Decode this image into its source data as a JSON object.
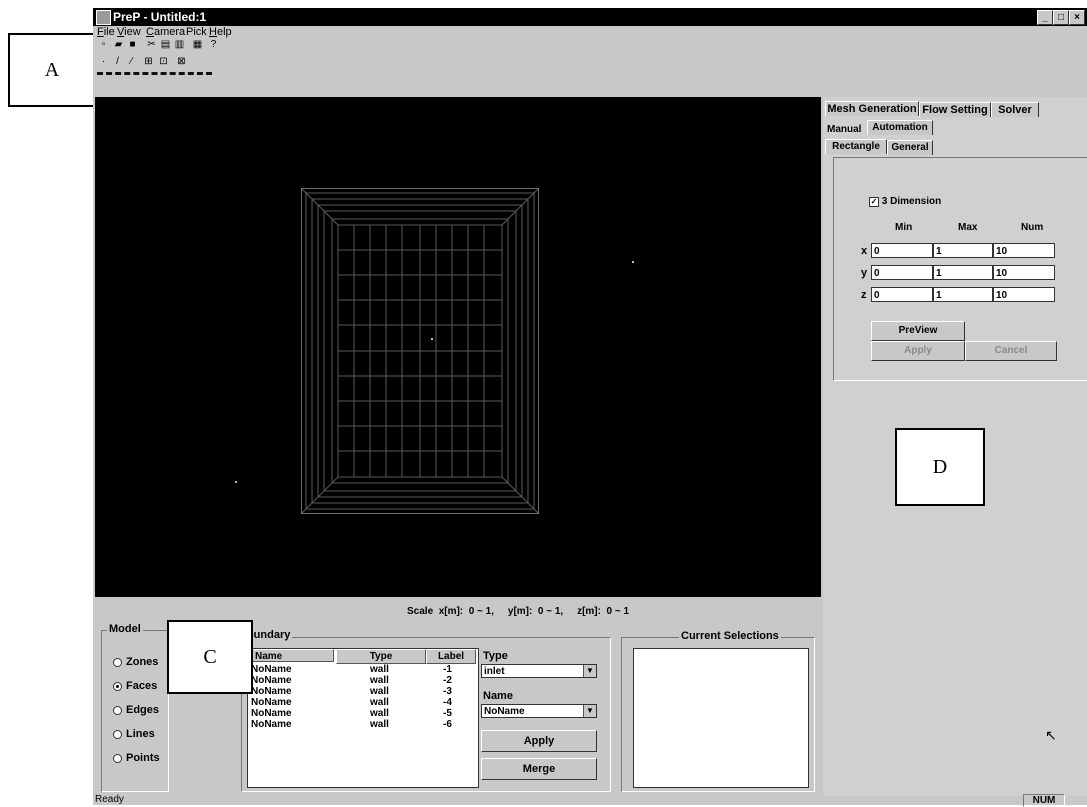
{
  "window": {
    "title": "PreP - Untitled:1",
    "status": "Ready",
    "num_indicator": "NUM"
  },
  "menu": [
    {
      "label": "File",
      "underline": "F",
      "rest": "ile"
    },
    {
      "label": "View",
      "underline": "V",
      "rest": "iew"
    },
    {
      "label": "Camera",
      "underline": "C",
      "rest": "amera"
    },
    {
      "label": "Pick",
      "underline": "",
      "rest": "Pick"
    },
    {
      "label": "Help",
      "underline": "H",
      "rest": "elp"
    }
  ],
  "callouts": {
    "a": "A",
    "c": "C",
    "d": "D"
  },
  "scale": {
    "text": "Scale  x[m]:  0 ~ 1,     y[m]:  0 ~ 1,     z[m]:  0 ~ 1"
  },
  "model": {
    "title": "Model",
    "options": [
      "Zones",
      "Faces",
      "Edges",
      "Lines",
      "Points"
    ],
    "selected": "Faces"
  },
  "boundary": {
    "title": "Boundary",
    "columns": [
      "Name",
      "Type",
      "Label"
    ],
    "rows": [
      {
        "name": "NoName",
        "type": "wall",
        "label": "-1"
      },
      {
        "name": "NoName",
        "type": "wall",
        "label": "-2"
      },
      {
        "name": "NoName",
        "type": "wall",
        "label": "-3"
      },
      {
        "name": "NoName",
        "type": "wall",
        "label": "-4"
      },
      {
        "name": "NoName",
        "type": "wall",
        "label": "-5"
      },
      {
        "name": "NoName",
        "type": "wall",
        "label": "-6"
      }
    ],
    "type_label": "Type",
    "type_value": "inlet",
    "name_label": "Name",
    "name_value": "NoName",
    "apply": "Apply",
    "merge": "Merge"
  },
  "current_selections": {
    "title": "Current Selections"
  },
  "tabs": {
    "main": [
      "Mesh Generation",
      "Flow Setting",
      "Solver"
    ],
    "sub": [
      "Manual",
      "Automation"
    ],
    "shape": [
      "Rectangle",
      "General"
    ]
  },
  "mesh": {
    "three_d_label": "3 Dimension",
    "three_d_checked": true,
    "headers": [
      "Min",
      "Max",
      "Num"
    ],
    "axes": [
      {
        "axis": "x",
        "min": "0",
        "max": "1",
        "num": "10"
      },
      {
        "axis": "y",
        "min": "0",
        "max": "1",
        "num": "10"
      },
      {
        "axis": "z",
        "min": "0",
        "max": "1",
        "num": "10"
      }
    ],
    "preview": "PreView",
    "apply": "Apply",
    "cancel": "Cancel"
  }
}
